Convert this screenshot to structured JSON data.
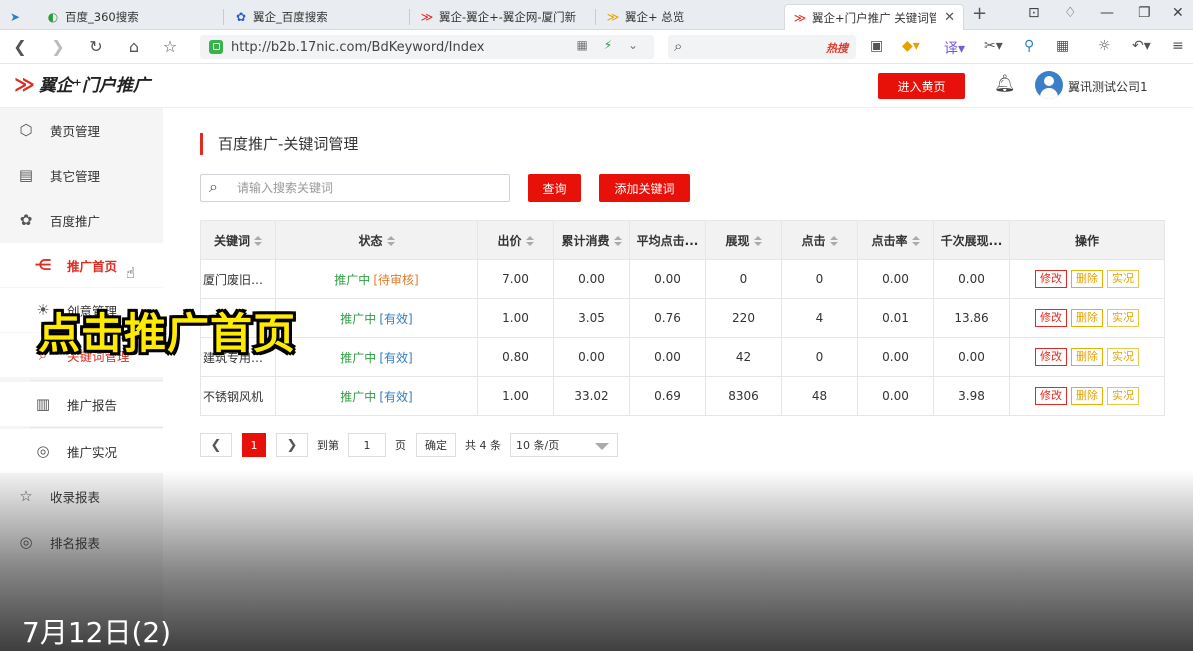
{
  "browser": {
    "tabs": [
      {
        "label": "百度_360搜索",
        "icon": "360-search-icon"
      },
      {
        "label": "翼企_百度搜索",
        "icon": "baidu-paw-icon"
      },
      {
        "label": "翼企-翼企+-翼企网-厦门新",
        "icon": "yiqi-logo-icon"
      },
      {
        "label": "翼企+ 总览",
        "icon": "yiqi-logo-icon"
      },
      {
        "label": "翼企+门户推广 关键词管理",
        "icon": "yiqi-logo-icon",
        "active": true
      }
    ],
    "url": "http://b2b.17nic.com/BdKeyword/Index",
    "hot_search": "热搜"
  },
  "header": {
    "logo_text": "翼企⁺门户推广",
    "enter_button": "进入黄页",
    "company": "翼讯测试公司1"
  },
  "sidebar": {
    "items": [
      {
        "label": "黄页管理",
        "icon": "cube-icon"
      },
      {
        "label": "其它管理",
        "icon": "card-icon"
      },
      {
        "label": "百度推广",
        "icon": "paw-icon"
      },
      {
        "label": "推广首页",
        "icon": "share-icon",
        "active": true
      },
      {
        "label": "创意管理",
        "icon": "bulb-icon"
      },
      {
        "label": "关键词管理",
        "icon": "search-doc-icon"
      },
      {
        "label": "推广报告",
        "icon": "report-icon"
      },
      {
        "label": "推广实况",
        "icon": "target-icon"
      },
      {
        "label": "收录报表",
        "icon": "star-doc-icon"
      },
      {
        "label": "排名报表",
        "icon": "target-icon"
      }
    ]
  },
  "main": {
    "title": "百度推广-关键词管理",
    "search_placeholder": "请输入搜索关键词",
    "query_button": "查询",
    "add_button": "添加关键词",
    "columns": [
      "关键词",
      "状态",
      "出价",
      "累计消费",
      "平均点击...",
      "展现",
      "点击",
      "点击率",
      "千次展现...",
      "操作"
    ],
    "rows": [
      {
        "keyword": "厦门废旧物...",
        "status": "推广中",
        "sub": "[待审核]",
        "sub_color": "orange",
        "bid": "7.00",
        "cost": "0.00",
        "avg": "0.00",
        "views": "0",
        "clicks": "0",
        "ctr": "0.00",
        "cpm": "0.00"
      },
      {
        "keyword": "",
        "status": "推广中",
        "sub": "[有效]",
        "sub_color": "blue",
        "bid": "1.00",
        "cost": "3.05",
        "avg": "0.76",
        "views": "220",
        "clicks": "4",
        "ctr": "0.01",
        "cpm": "13.86"
      },
      {
        "keyword": "建筑专用风...",
        "status": "推广中",
        "sub": "[有效]",
        "sub_color": "blue",
        "bid": "0.80",
        "cost": "0.00",
        "avg": "0.00",
        "views": "42",
        "clicks": "0",
        "ctr": "0.00",
        "cpm": "0.00"
      },
      {
        "keyword": "不锈钢风机",
        "status": "推广中",
        "sub": "[有效]",
        "sub_color": "blue",
        "bid": "1.00",
        "cost": "33.02",
        "avg": "0.69",
        "views": "8306",
        "clicks": "48",
        "ctr": "0.00",
        "cpm": "3.98"
      }
    ],
    "actions": [
      "修改",
      "删除",
      "实况"
    ],
    "pager": {
      "current": "1",
      "goto_label": "到第",
      "goto_value": "1",
      "page_unit": "页",
      "confirm": "确定",
      "total": "共 4 条",
      "page_size": "10 条/页"
    }
  },
  "overlay": {
    "caption": "点击推广首页",
    "date": "7月12日(2)"
  }
}
